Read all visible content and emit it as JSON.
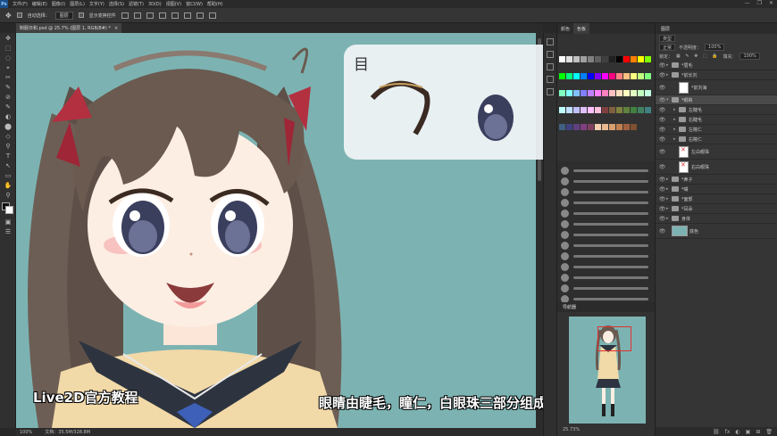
{
  "menu": {
    "logo": "Ps",
    "items": [
      "文件(F)",
      "编辑(E)",
      "图像(I)",
      "图层(L)",
      "文字(Y)",
      "选择(S)",
      "滤镜(T)",
      "3D(D)",
      "视图(V)",
      "窗口(W)",
      "帮助(H)"
    ]
  },
  "window_controls": [
    "—",
    "❐",
    "✕"
  ],
  "options": {
    "auto_select_label": "自动选择：",
    "auto_select_value": "图层",
    "transform_label": "显示变换控件"
  },
  "document_tab": {
    "title": "制服日和.psd @ 25.7% (图层 1, RGB/8#) *",
    "close": "×"
  },
  "tools": [
    "✥",
    "⬚",
    "◌",
    "⌖",
    "✂",
    "✎",
    "⊘",
    "✎",
    "◐",
    "⬤",
    "◇",
    "⚲",
    "T",
    "↖",
    "▭",
    "✋",
    "⚲",
    "◧",
    "▣",
    "☰"
  ],
  "overlay": {
    "title": "目"
  },
  "captions": {
    "left": "Live2D官方教程",
    "main": "眼睛由睫毛，瞳仁，白眼珠三部分组成"
  },
  "status": {
    "zoom": "100%",
    "doc": "文档：35.5M/328.8M"
  },
  "color_panel": {
    "tabs": [
      "颜色",
      "色板"
    ],
    "swatch_colors": [
      "#ffffff",
      "#e0e0e0",
      "#c0c0c0",
      "#a0a0a0",
      "#808080",
      "#606060",
      "#404040",
      "#202020",
      "#000000",
      "#ff0000",
      "#ff8000",
      "#ffff00",
      "#80ff00",
      "#00ff00",
      "#00ff80",
      "#00ffff",
      "#0080ff",
      "#0000ff",
      "#8000ff",
      "#ff00ff",
      "#ff0080",
      "#ff8080",
      "#ffc080",
      "#ffff80",
      "#c0ff80",
      "#80ff80",
      "#80ffc0",
      "#80ffff",
      "#80c0ff",
      "#8080ff",
      "#c080ff",
      "#ff80ff",
      "#ff80c0",
      "#ffc0c0",
      "#ffe0c0",
      "#ffffc0",
      "#e0ffc0",
      "#c0ffc0",
      "#c0ffe0",
      "#c0ffff",
      "#c0e0ff",
      "#c0c0ff",
      "#e0c0ff",
      "#ffc0ff",
      "#ffc0e0",
      "#804040",
      "#806040",
      "#808040",
      "#608040",
      "#408040",
      "#408060",
      "#408080",
      "#406080",
      "#404080",
      "#604080",
      "#804080",
      "#804060",
      "#f4d0b0",
      "#e8b890",
      "#d8a070",
      "#c08050",
      "#a06040",
      "#805030"
    ]
  },
  "navigator": {
    "tab": "导航器",
    "zoom": "25.73%"
  },
  "layers": {
    "tab": "图层",
    "kind": "类型",
    "blend": "正常",
    "opacity_label": "不透明度：",
    "opacity": "100%",
    "lock_label": "锁定：",
    "fill_label": "填充：",
    "fill": "100%",
    "rows": [
      {
        "name": "*眉毛",
        "type": "folder",
        "indent": 0
      },
      {
        "name": "*前长刘",
        "type": "folder",
        "indent": 0
      },
      {
        "name": "*前刘海",
        "type": "white",
        "indent": 1
      },
      {
        "name": "*眼睛",
        "type": "folder",
        "indent": 0,
        "selected": true
      },
      {
        "name": "左睫毛",
        "type": "folder",
        "indent": 1
      },
      {
        "name": "右睫毛",
        "type": "folder",
        "indent": 1
      },
      {
        "name": "左瞳仁",
        "type": "folder",
        "indent": 1
      },
      {
        "name": "右瞳仁",
        "type": "folder",
        "indent": 1
      },
      {
        "name": "左白眼珠",
        "type": "x",
        "indent": 1
      },
      {
        "name": "右白眼珠",
        "type": "x",
        "indent": 1
      },
      {
        "name": "*鼻子",
        "type": "folder",
        "indent": 0
      },
      {
        "name": "*嘴",
        "type": "folder",
        "indent": 0
      },
      {
        "name": "*面部",
        "type": "folder",
        "indent": 0
      },
      {
        "name": "*耳朵",
        "type": "folder",
        "indent": 0
      },
      {
        "name": "身体",
        "type": "folder",
        "indent": 0
      },
      {
        "name": "底色",
        "type": "color",
        "indent": 0
      }
    ],
    "footer_icons": [
      "⛓",
      "fx",
      "◐",
      "▣",
      "⊞",
      "🗑"
    ]
  }
}
